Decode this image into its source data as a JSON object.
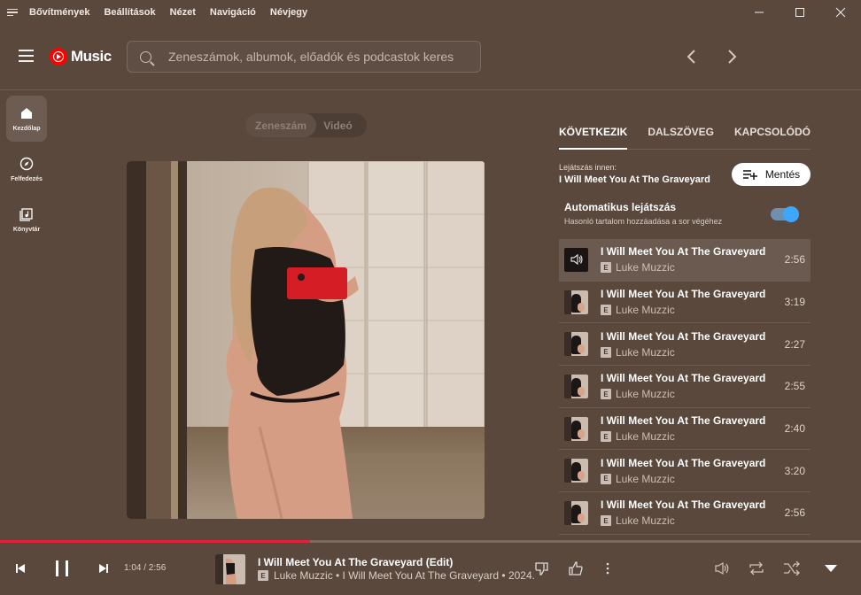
{
  "menubar": {
    "items": [
      "Bővítmények",
      "Beállítások",
      "Nézet",
      "Navigáció",
      "Névjegy"
    ]
  },
  "app": {
    "logo_text": "Music"
  },
  "search": {
    "placeholder": "Zeneszámok, albumok, előadók és podcastok keres"
  },
  "leftnav": {
    "items": [
      {
        "label": "Kezdőlap",
        "icon": "home-icon",
        "active": true
      },
      {
        "label": "Felfedezés",
        "icon": "compass-icon",
        "active": false
      },
      {
        "label": "Könyvtár",
        "icon": "library-icon",
        "active": false
      }
    ]
  },
  "mode_toggle": {
    "song": "Zeneszám",
    "video": "Videó"
  },
  "right_panel": {
    "tabs": [
      "KÖVETKEZIK",
      "DALSZÖVEG",
      "KAPCSOLÓDÓ"
    ],
    "playing_from_label": "Lejátszás innen:",
    "playing_from_title": "I Will Meet You At The Graveyard",
    "save_label": "Mentés",
    "autoplay_title": "Automatikus lejátszás",
    "autoplay_subtitle": "Hasonló tartalom hozzáadása a sor végéhez",
    "autoplay_on": true
  },
  "queue": [
    {
      "title": "I Will Meet You At The Graveyard (...",
      "artist": "Luke Muzzic",
      "explicit": "E",
      "duration": "2:56",
      "current": true
    },
    {
      "title": "I Will Meet You At The Graveyard (...",
      "artist": "Luke Muzzic",
      "explicit": "E",
      "duration": "3:19",
      "current": false
    },
    {
      "title": "I Will Meet You At The Graveyard (...",
      "artist": "Luke Muzzic",
      "explicit": "E",
      "duration": "2:27",
      "current": false
    },
    {
      "title": "I Will Meet You At The Graveyard (...",
      "artist": "Luke Muzzic",
      "explicit": "E",
      "duration": "2:55",
      "current": false
    },
    {
      "title": "I Will Meet You At The Graveyard (...",
      "artist": "Luke Muzzic",
      "explicit": "E",
      "duration": "2:40",
      "current": false
    },
    {
      "title": "I Will Meet You At The Graveyard (...",
      "artist": "Luke Muzzic",
      "explicit": "E",
      "duration": "3:20",
      "current": false
    },
    {
      "title": "I Will Meet You At The Graveyard (...",
      "artist": "Luke Muzzic",
      "explicit": "E",
      "duration": "2:56",
      "current": false
    }
  ],
  "player": {
    "time": "1:04 / 2:56",
    "progress_fraction": 0.36,
    "title": "I Will Meet You At The Graveyard (Edit)",
    "explicit": "E",
    "subtitle": "Luke Muzzic • I Will Meet You At The Graveyard • 2024."
  },
  "colors": {
    "background": "#5a483d",
    "accent": "#e0223a",
    "toggle": "#3ea6ff"
  }
}
